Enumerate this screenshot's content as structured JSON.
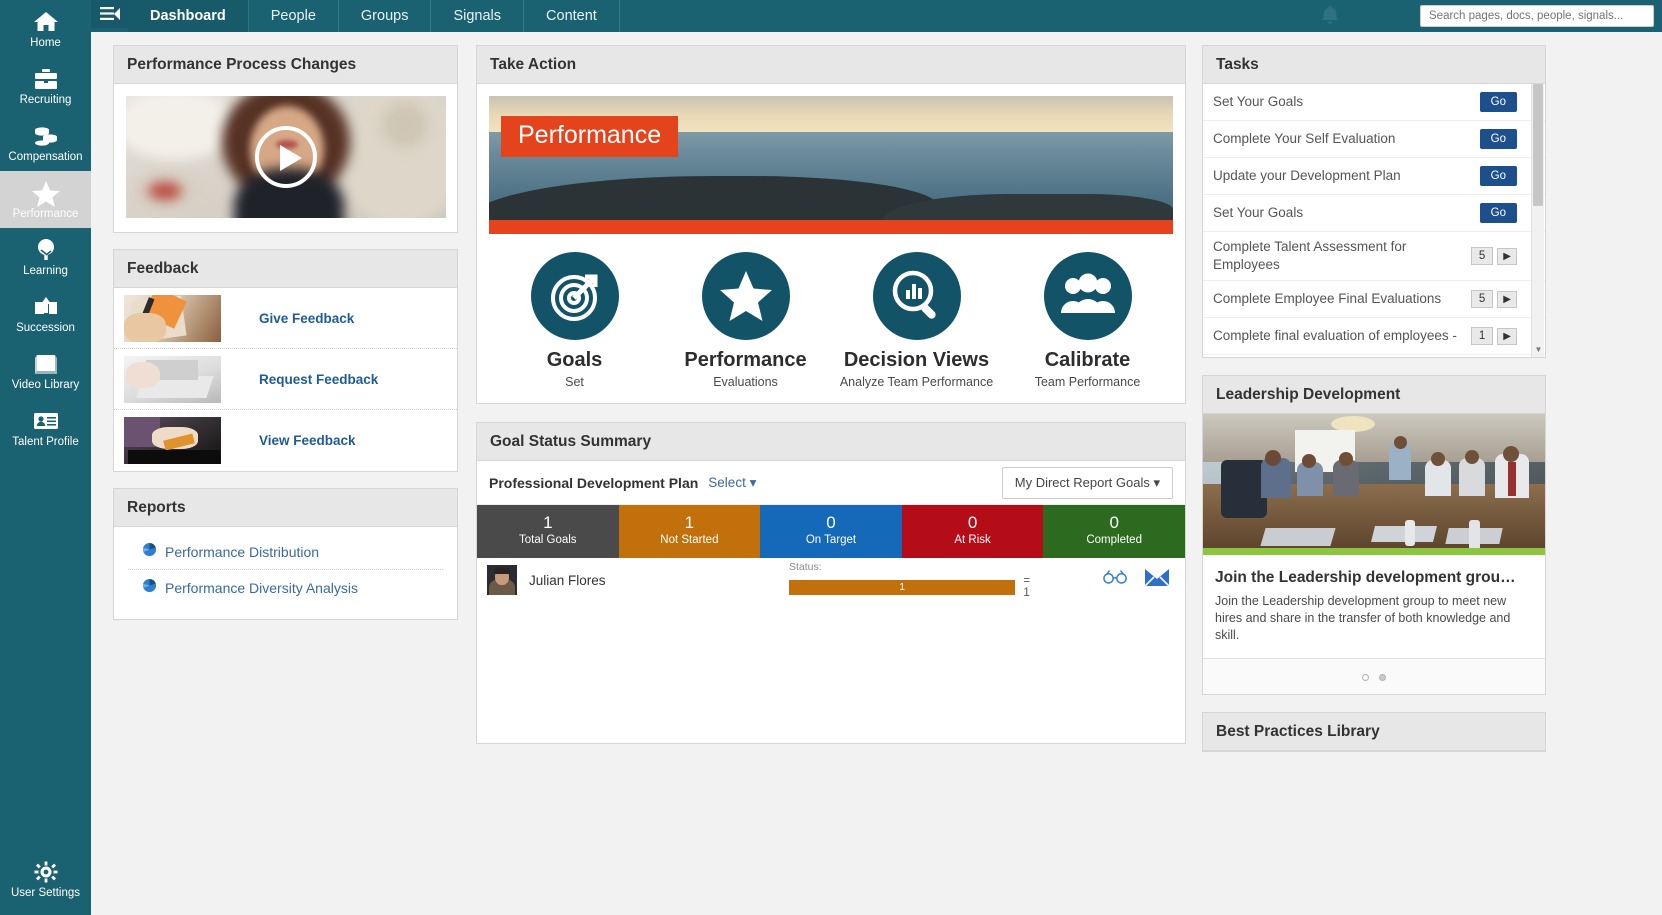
{
  "app": {
    "accent_teal": "#1a6272",
    "accent_orange": "#c2700c",
    "accent_red": "#e5431c",
    "link_blue": "#1f5b96"
  },
  "left_rail": {
    "items": [
      {
        "label": "Home",
        "icon": "home-icon",
        "active": false
      },
      {
        "label": "Recruiting",
        "icon": "briefcase-icon",
        "active": false
      },
      {
        "label": "Compensation",
        "icon": "coins-icon",
        "active": false
      },
      {
        "label": "Performance",
        "icon": "star-icon",
        "active": true
      },
      {
        "label": "Learning",
        "icon": "tree-icon",
        "active": false
      },
      {
        "label": "Succession",
        "icon": "arrow-up-box-icon",
        "active": false
      },
      {
        "label": "Video Library",
        "icon": "book-icon",
        "active": false
      },
      {
        "label": "Talent Profile",
        "icon": "id-card-icon",
        "active": false
      }
    ],
    "settings": {
      "label": "User Settings",
      "icon": "gear-icon"
    }
  },
  "topbar": {
    "menu_icon": "hamburger-menu-icon",
    "tabs": [
      {
        "label": "Dashboard",
        "active": true
      },
      {
        "label": "People",
        "active": false
      },
      {
        "label": "Groups",
        "active": false
      },
      {
        "label": "Signals",
        "active": false
      },
      {
        "label": "Content",
        "active": false
      }
    ],
    "bell_icon": "notification-bell-icon",
    "search": {
      "placeholder": "Search pages, docs, people, signals...",
      "value": ""
    }
  },
  "performance_process_changes": {
    "title": "Performance Process Changes",
    "play_icon": "play-button-icon"
  },
  "feedback": {
    "title": "Feedback",
    "items": [
      {
        "label": "Give Feedback"
      },
      {
        "label": "Request Feedback"
      },
      {
        "label": "View Feedback"
      }
    ]
  },
  "reports": {
    "title": "Reports",
    "items": [
      {
        "label": "Performance Distribution",
        "icon": "pie-chart-icon"
      },
      {
        "label": "Performance Diversity Analysis",
        "icon": "pie-chart-icon"
      }
    ]
  },
  "take_action": {
    "title": "Take Action",
    "banner_tag": "Performance",
    "actions": [
      {
        "title": "Goals",
        "sub": "Set",
        "icon": "target-arrow-icon"
      },
      {
        "title": "Performance",
        "sub": "Evaluations",
        "icon": "star-icon"
      },
      {
        "title": "Decision Views",
        "sub": "Analyze Team Performance",
        "icon": "magnifier-chart-icon"
      },
      {
        "title": "Calibrate",
        "sub": "Team Performance",
        "icon": "people-group-icon"
      }
    ]
  },
  "goal_status_summary": {
    "title": "Goal Status Summary",
    "plan_name": "Professional Development Plan",
    "select_label": "Select",
    "scope_dropdown": "My Direct Report Goals",
    "tiles": [
      {
        "value": "1",
        "label": "Total Goals",
        "color": "#4a4a4a",
        "selected": true
      },
      {
        "value": "1",
        "label": "Not Started",
        "color": "#c2700c",
        "selected": false
      },
      {
        "value": "0",
        "label": "On Target",
        "color": "#1469b8",
        "selected": false
      },
      {
        "value": "0",
        "label": "At Risk",
        "color": "#b50d17",
        "selected": false
      },
      {
        "value": "0",
        "label": "Completed",
        "color": "#2c6b1f",
        "selected": false
      }
    ],
    "rows": [
      {
        "name": "Julian Flores",
        "status_label": "Status:",
        "bar_value": "1",
        "equals": "= 1",
        "icons": [
          "binoculars-icon",
          "envelope-icon"
        ]
      }
    ]
  },
  "tasks": {
    "title": "Tasks",
    "items": [
      {
        "label": "Set Your Goals",
        "action": "Go",
        "count": null
      },
      {
        "label": "Complete Your Self Evaluation",
        "action": "Go",
        "count": null
      },
      {
        "label": "Update your Development Plan",
        "action": "Go",
        "count": null
      },
      {
        "label": "Set Your Goals",
        "action": "Go",
        "count": null
      },
      {
        "label": "Complete Talent Assessment for Employees",
        "action": null,
        "count": "5"
      },
      {
        "label": "Complete Employee Final Evaluations",
        "action": null,
        "count": "5"
      },
      {
        "label": "Complete final evaluation of employees -",
        "action": null,
        "count": "1"
      }
    ],
    "scroll_down_icon": "chevron-down-icon"
  },
  "leadership_development": {
    "title": "Leadership Development",
    "headline": "Join the Leadership development grou…",
    "description": "Join the Leadership development group to meet new hires and share in the transfer of both knowledge and skill.",
    "dots": [
      {
        "active": false
      },
      {
        "active": true
      }
    ]
  },
  "best_practices": {
    "title": "Best Practices Library"
  }
}
